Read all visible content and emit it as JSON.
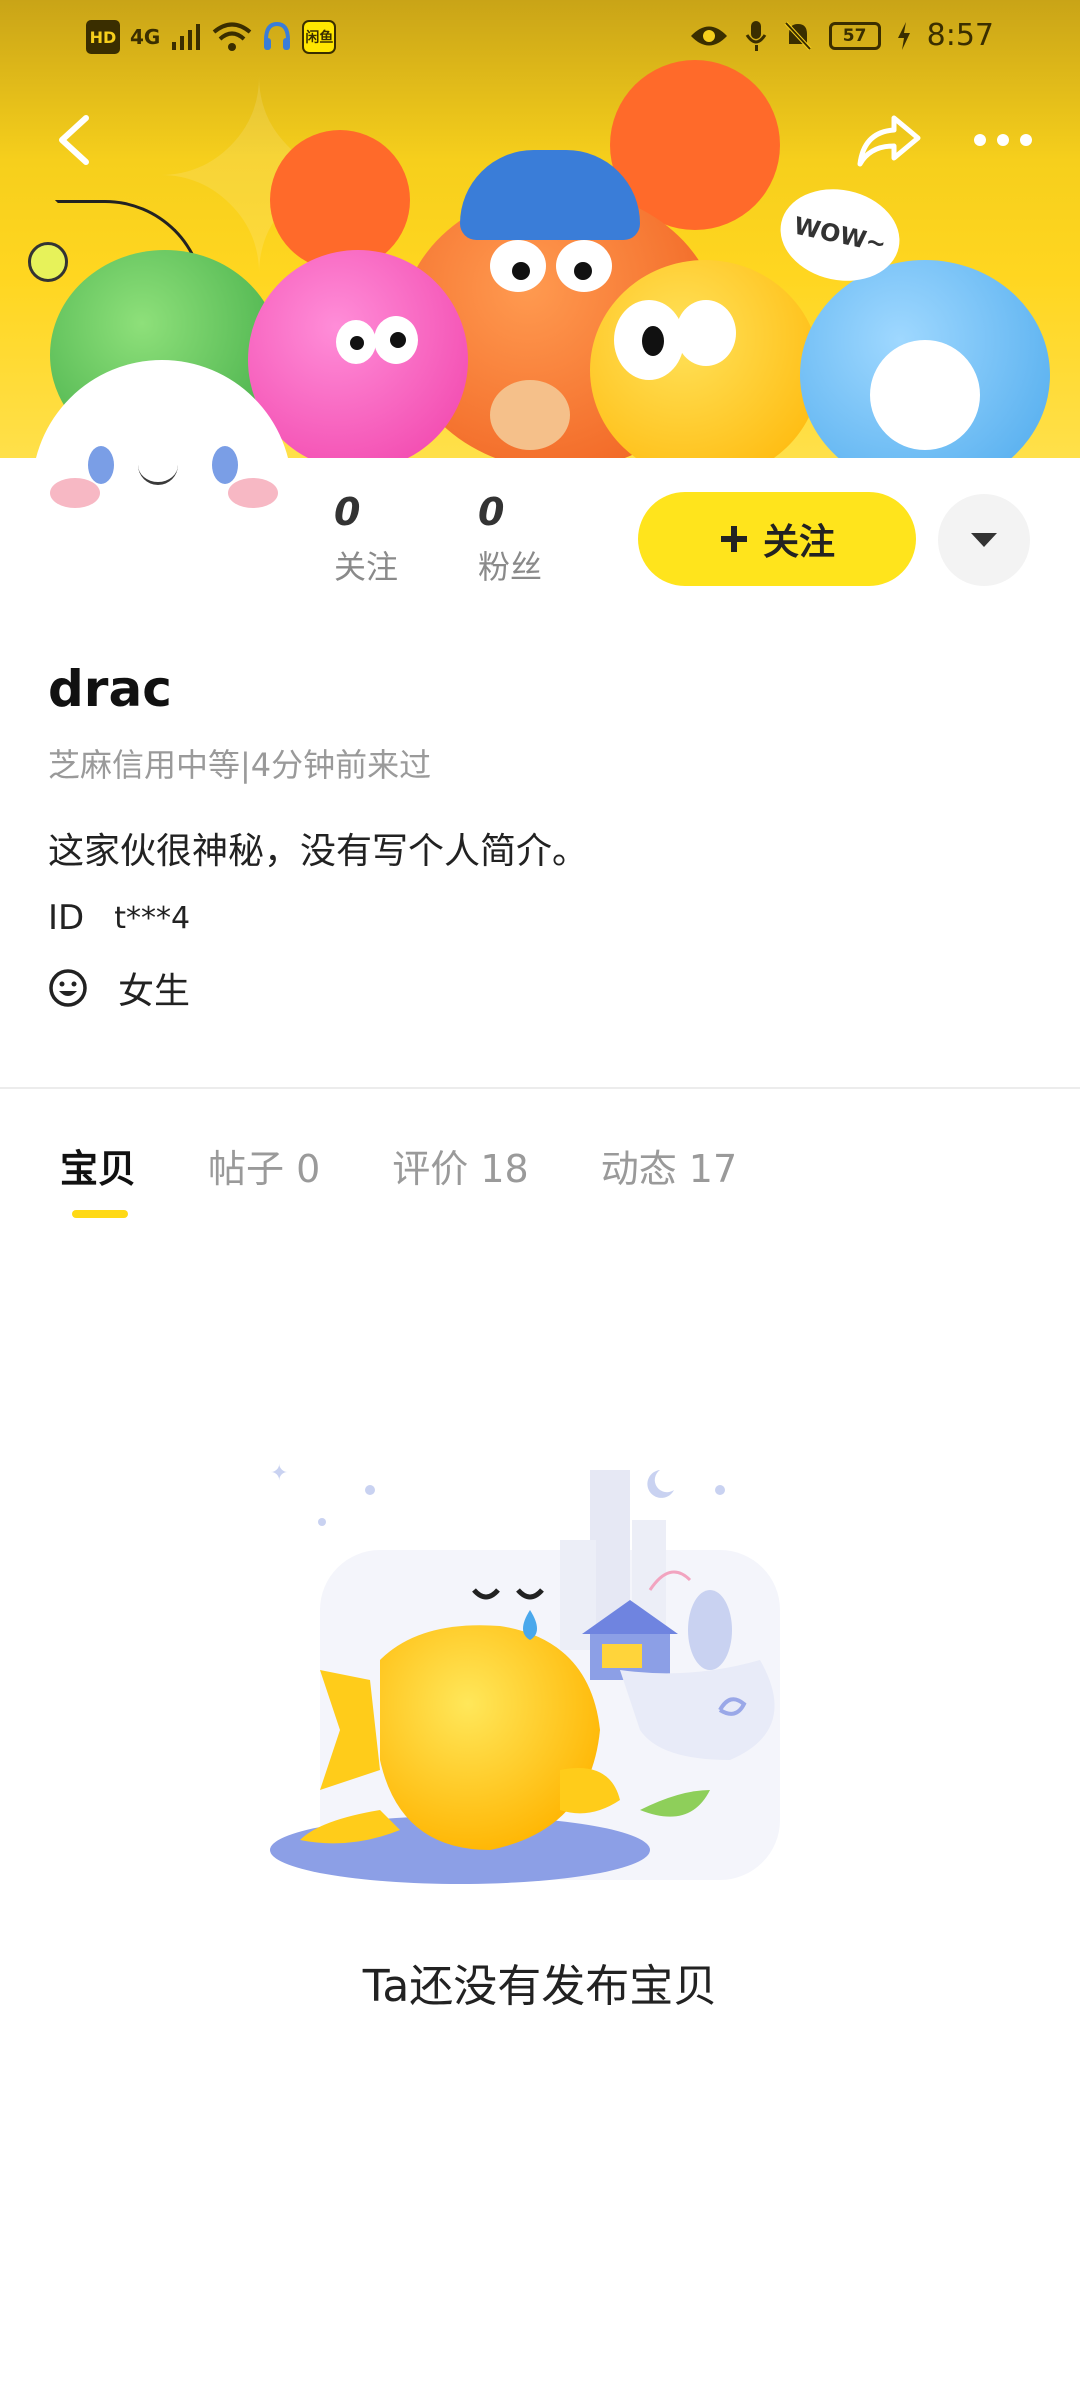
{
  "status_bar": {
    "hd": "HD",
    "network": "4G",
    "app_badge": "闲鱼",
    "battery": "57",
    "time": "8:57"
  },
  "banner": {
    "bubble_text": "WOW~"
  },
  "stats": [
    {
      "value": "0",
      "label": "关注"
    },
    {
      "value": "0",
      "label": "粉丝"
    }
  ],
  "follow_button": {
    "icon": "plus-icon",
    "label": "关注"
  },
  "profile": {
    "username": "drac",
    "subinfo": "芝麻信用中等|4分钟前来过",
    "bio": "这家伙很神秘，没有写个人简介。",
    "id_label": "ID",
    "id_value": "t***4",
    "gender": "女生"
  },
  "tabs": [
    {
      "label": "宝贝",
      "active": true
    },
    {
      "label": "帖子 0",
      "active": false
    },
    {
      "label": "评价 18",
      "active": false
    },
    {
      "label": "动态 17",
      "active": false
    }
  ],
  "empty_state": {
    "message": "Ta还没有发布宝贝"
  },
  "colors": {
    "accent": "#ffe41c",
    "banner": "#f6cf1c",
    "muted_text": "#9a9a9a"
  }
}
